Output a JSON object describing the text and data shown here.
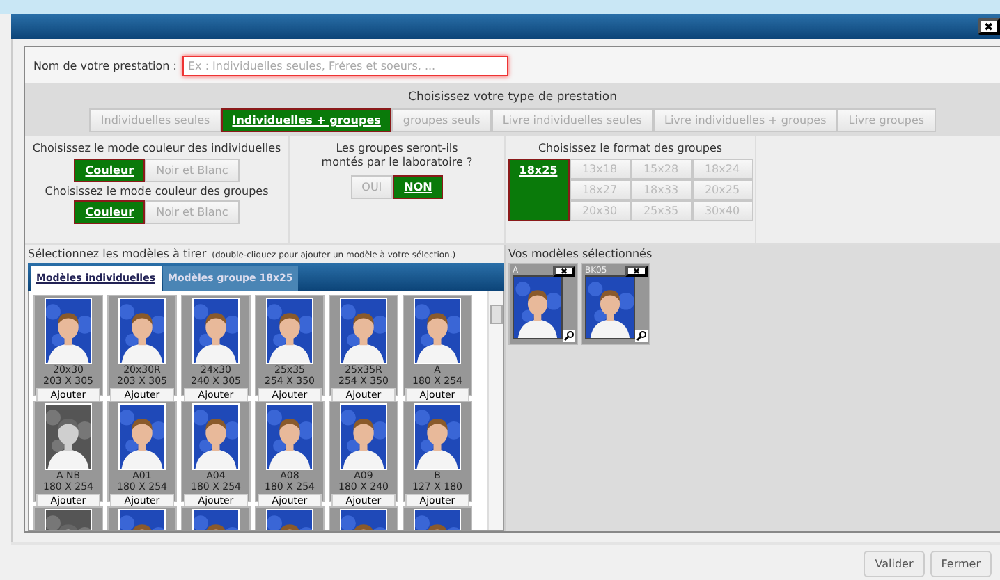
{
  "dialog": {
    "close": "✖"
  },
  "name_field": {
    "label": "Nom de votre prestation :",
    "placeholder": "Ex : Individuelles seules, Fréres et soeurs, ..."
  },
  "type_section": {
    "title": "Choisissez votre type de prestation",
    "options": [
      {
        "label": "Individuelles seules",
        "selected": false
      },
      {
        "label": "Individuelles + groupes",
        "selected": true
      },
      {
        "label": "groupes seuls",
        "selected": false
      },
      {
        "label": "Livre individuelles seules",
        "selected": false
      },
      {
        "label": "Livre individuelles + groupes",
        "selected": false
      },
      {
        "label": "Livre groupes",
        "selected": false
      }
    ]
  },
  "color_modes": [
    {
      "title": "Choisissez le mode couleur des individuelles",
      "options": [
        {
          "label": "Couleur",
          "selected": true
        },
        {
          "label": "Noir et Blanc",
          "selected": false
        }
      ]
    },
    {
      "title": "Choisissez le mode couleur des groupes",
      "options": [
        {
          "label": "Couleur",
          "selected": true
        },
        {
          "label": "Noir et Blanc",
          "selected": false
        }
      ]
    }
  ],
  "lab_mount": {
    "title": "Les groupes seront-ils montés par le laboratoire ?",
    "options": [
      {
        "label": "OUI",
        "selected": false
      },
      {
        "label": "NON",
        "selected": true
      }
    ]
  },
  "group_formats": {
    "title": "Choisissez le format des groupes",
    "options": [
      {
        "label": "18x25",
        "selected": true
      },
      {
        "label": "13x18",
        "selected": false
      },
      {
        "label": "15x28",
        "selected": false
      },
      {
        "label": "18x24",
        "selected": false
      },
      {
        "label": "18x27",
        "selected": false
      },
      {
        "label": "18x33",
        "selected": false
      },
      {
        "label": "20x25",
        "selected": false
      },
      {
        "label": "20x30",
        "selected": false
      },
      {
        "label": "25x35",
        "selected": false
      },
      {
        "label": "30x40",
        "selected": false
      }
    ]
  },
  "models": {
    "title": "Sélectionnez les modèles à tirer",
    "hint": "(double-cliquez pour ajouter un modèle à votre sélection.)",
    "tabs": [
      {
        "label": "Modèles individuelles",
        "selected": true
      },
      {
        "label": "Modèles groupe 18x25",
        "selected": false
      }
    ],
    "tiles": [
      {
        "kind": "model",
        "name": "20x30",
        "size": "203 X 305",
        "button": "Ajouter",
        "monochrome": false
      },
      {
        "kind": "model",
        "name": "20x30R",
        "size": "203 X 305",
        "button": "Ajouter",
        "monochrome": false
      },
      {
        "kind": "model",
        "name": "24x30",
        "size": "240 X 305",
        "button": "Ajouter",
        "monochrome": false
      },
      {
        "kind": "model",
        "name": "25x35",
        "size": "254 X 350",
        "button": "Ajouter",
        "monochrome": false
      },
      {
        "kind": "model",
        "name": "25x35R",
        "size": "254 X 350",
        "button": "Ajouter",
        "monochrome": false
      },
      {
        "kind": "model",
        "name": "A",
        "size": "180 X 254",
        "button": "Ajouter",
        "monochrome": false
      },
      {
        "kind": "model",
        "name": "A NB",
        "size": "180 X 254",
        "button": "Ajouter",
        "monochrome": true
      },
      {
        "kind": "model",
        "name": "A01",
        "size": "180 X 254",
        "button": "Ajouter",
        "monochrome": false
      },
      {
        "kind": "model",
        "name": "A04",
        "size": "180 X 254",
        "button": "Ajouter",
        "monochrome": false
      },
      {
        "kind": "model",
        "name": "A08",
        "size": "180 X 254",
        "button": "Ajouter",
        "monochrome": false
      },
      {
        "kind": "model",
        "name": "A09",
        "size": "180 X 240",
        "button": "Ajouter",
        "monochrome": false
      },
      {
        "kind": "model",
        "name": "B",
        "size": "127 X 180",
        "button": "Ajouter",
        "monochrome": false
      },
      {
        "kind": "picture",
        "monochrome": true
      },
      {
        "kind": "picture",
        "monochrome": false
      },
      {
        "kind": "picture",
        "monochrome": false
      },
      {
        "kind": "picture",
        "monochrome": false
      },
      {
        "kind": "picture",
        "monochrome": false
      },
      {
        "kind": "picture",
        "monochrome": false
      }
    ]
  },
  "selected_models": {
    "title": "Vos modèles sélectionnés",
    "items": [
      {
        "name": "A"
      },
      {
        "name": "BK05"
      }
    ]
  },
  "buttons": [
    "Valider",
    "Fermer"
  ]
}
